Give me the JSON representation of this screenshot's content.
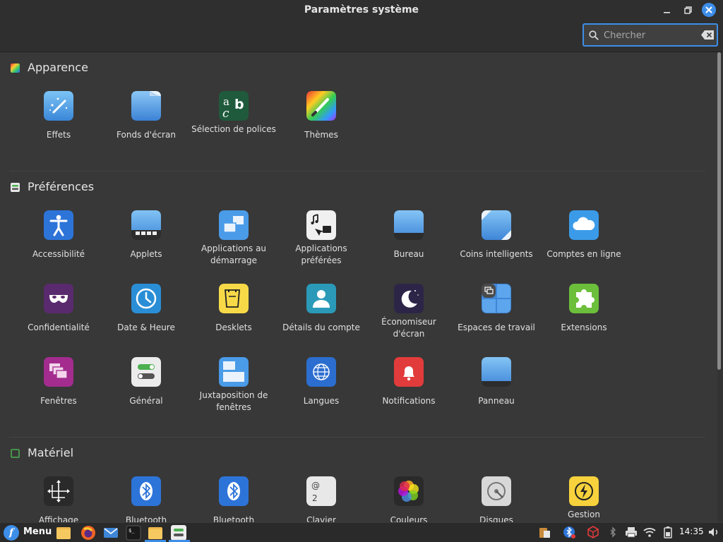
{
  "window": {
    "title": "Paramètres système",
    "search_placeholder": "Chercher"
  },
  "sections": {
    "appearance": {
      "label": "Apparence",
      "items": [
        {
          "label": "Effets"
        },
        {
          "label": "Fonds d'écran"
        },
        {
          "label": "Sélection de polices"
        },
        {
          "label": "Thèmes"
        }
      ]
    },
    "preferences": {
      "label": "Préférences",
      "items": [
        {
          "label": "Accessibilité"
        },
        {
          "label": "Applets"
        },
        {
          "label": "Applications au démarrage"
        },
        {
          "label": "Applications préférées"
        },
        {
          "label": "Bureau"
        },
        {
          "label": "Coins intelligents"
        },
        {
          "label": "Comptes en ligne"
        },
        {
          "label": "Confidentialité"
        },
        {
          "label": "Date & Heure"
        },
        {
          "label": "Desklets"
        },
        {
          "label": "Détails du compte"
        },
        {
          "label": "Économiseur d'écran"
        },
        {
          "label": "Espaces de travail"
        },
        {
          "label": "Extensions"
        },
        {
          "label": "Fenêtres"
        },
        {
          "label": "Général"
        },
        {
          "label": "Juxtaposition de fenêtres"
        },
        {
          "label": "Langues"
        },
        {
          "label": "Notifications"
        },
        {
          "label": "Panneau"
        }
      ]
    },
    "hardware": {
      "label": "Matériel",
      "items": [
        {
          "label": "Affichage"
        },
        {
          "label": "Bluetooth"
        },
        {
          "label": "Bluetooth"
        },
        {
          "label": "Clavier"
        },
        {
          "label": "Couleurs"
        },
        {
          "label": "Disques"
        },
        {
          "label": "Gestion"
        }
      ]
    }
  },
  "taskbar": {
    "menu_label": "Menu",
    "clock": "14:35"
  },
  "colors": {
    "accent": "#3d8ee8",
    "window_bg": "#383838",
    "titlebar_bg": "#2f2f2f"
  }
}
